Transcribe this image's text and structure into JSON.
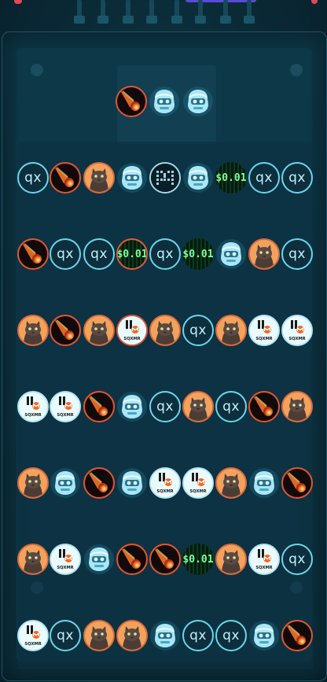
{
  "game": {
    "title": "",
    "tile_types": {
      "qx": {
        "label": "qx",
        "icon": "qx-token-icon"
      },
      "meteor": {
        "icon": "meteor-token-icon"
      },
      "cat": {
        "icon": "cat-token-icon"
      },
      "robot": {
        "icon": "robot-head-token-icon"
      },
      "chip": {
        "icon": "circuit-chip-token-icon"
      },
      "xmr": {
        "label": "SQXMR",
        "icon": "xmr-wallet-token-icon"
      },
      "dollar": {
        "label": "$0.01",
        "icon": "matrix-dollar-token-icon"
      }
    },
    "spawn_queue": [
      "meteor",
      "robot",
      "robot"
    ],
    "grid": [
      [
        "qx",
        "meteor",
        "cat",
        "robot",
        "chip",
        "robot",
        "dollar",
        "qx",
        "qx"
      ],
      [
        "meteor",
        "qx",
        "qx",
        "dollar-red",
        "qx",
        "dollar",
        "robot",
        "cat",
        "qx"
      ],
      [
        "cat",
        "meteor",
        "cat",
        "xmr-red",
        "cat",
        "qx",
        "cat",
        "xmr",
        "xmr"
      ],
      [
        "xmr",
        "xmr",
        "meteor",
        "robot",
        "qx",
        "cat",
        "qx",
        "meteor",
        "cat"
      ],
      [
        "cat",
        "robot",
        "meteor",
        "robot",
        "xmr",
        "xmr",
        "cat",
        "robot",
        "meteor"
      ],
      [
        "cat",
        "xmr",
        "robot",
        "meteor",
        "meteor",
        "dollar",
        "cat",
        "xmr",
        "qx"
      ],
      [
        "xmr",
        "qx",
        "cat",
        "cat",
        "robot",
        "qx",
        "qx",
        "robot",
        "meteor"
      ]
    ],
    "colors": {
      "background": "#0a2a36",
      "qx_ring": "#6ad6ec",
      "meteor_ring": "#e2562f",
      "dollar_text": "#7dff9a",
      "top_left_accent": "#e0485a",
      "top_mid_accent": "#5a4ad8"
    }
  }
}
